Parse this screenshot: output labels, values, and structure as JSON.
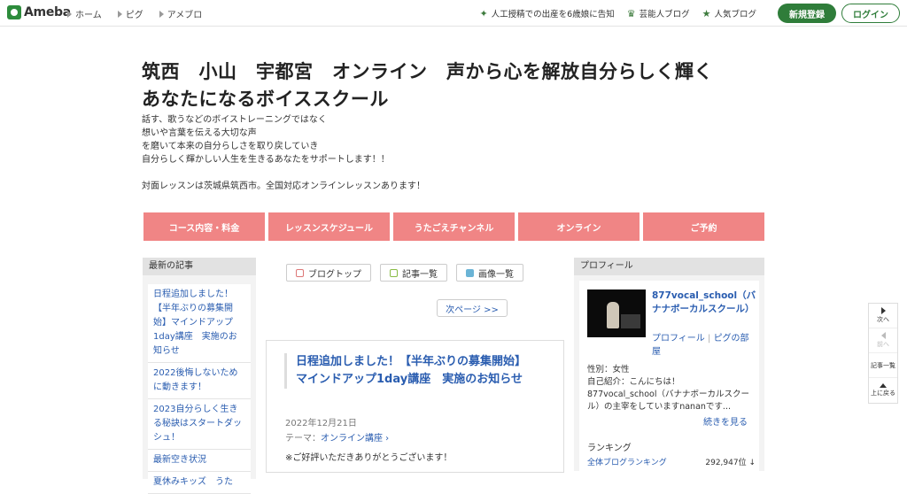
{
  "topbar": {
    "logo_text": "Ameba",
    "nav": [
      "ホーム",
      "ピグ",
      "アメブロ"
    ],
    "right_links": [
      {
        "label": "人工授精での出産を6歳娘に告知",
        "icon": "sparkle-icon"
      },
      {
        "label": "芸能人ブログ",
        "icon": "crown-icon"
      },
      {
        "label": "人気ブログ",
        "icon": "star-icon"
      }
    ],
    "signup_label": "新規登録",
    "login_label": "ログイン"
  },
  "blog": {
    "title_line1": "筑西　小山　宇都宮　オンライン　声から心を解放自分らしく輝く",
    "title_line2": "あなたになるボイススクール",
    "desc": [
      "話す、歌うなどのボイストレーニングではなく",
      "想いや言葉を伝える大切な声",
      "を磨いて本来の自分らしさを取り戻していき",
      "自分らしく輝かしい人生を生きるあなたをサポートします！！",
      "",
      "対面レッスンは茨城県筑西市。全国対応オンラインレッスンあります！"
    ]
  },
  "menu": [
    "コース内容・料金",
    "レッスンスケジュール",
    "うたごえチャンネル",
    "オンライン",
    "ご予約"
  ],
  "left_sidebar": {
    "heading": "最新の記事",
    "entries": [
      "日程追加しました！【半年ぶりの募集開始】マインドアップ1day講座　実施のお知らせ",
      "2022後悔しないために動きます！",
      "2023自分らしく生きる秘訣はスタートダッシュ！",
      "最新空き状況",
      "夏休みキッズ　うた"
    ]
  },
  "center": {
    "tabs": [
      "ブログトップ",
      "記事一覧",
      "画像一覧"
    ],
    "next_label": "次ページ >>",
    "article": {
      "title": "日程追加しました！【半年ぶりの募集開始】マインドアップ1day講座　実施のお知らせ",
      "date": "2022年12月21日",
      "theme_label": "テーマ：",
      "theme_value": "オンライン講座",
      "body": "※ご好評いただきありがとうございます！"
    }
  },
  "right_sidebar": {
    "heading": "プロフィール",
    "name": "877vocal_school（バナナボーカルスクール）",
    "link_profile": "プロフィール",
    "link_sep": "|",
    "link_pig": "ピグの部屋",
    "gender": "性別：女性",
    "intro_label": "自己紹介：こんにちは！",
    "intro_text": "877vocal_school（バナナボーカルスクール）の主宰をしていますnananです...",
    "more_label": "続きを見る",
    "ranking_heading": "ランキング",
    "ranking_label": "全体ブログランキング",
    "ranking_value": "292,947位 ↓"
  },
  "float_nav": {
    "next": "次へ",
    "prev": "前へ",
    "list": "記事一覧",
    "top": "上に戻る"
  },
  "colors": {
    "brand_green": "#2f7d3a",
    "menu_pink": "#f08585",
    "link_blue": "#2a5db0"
  }
}
